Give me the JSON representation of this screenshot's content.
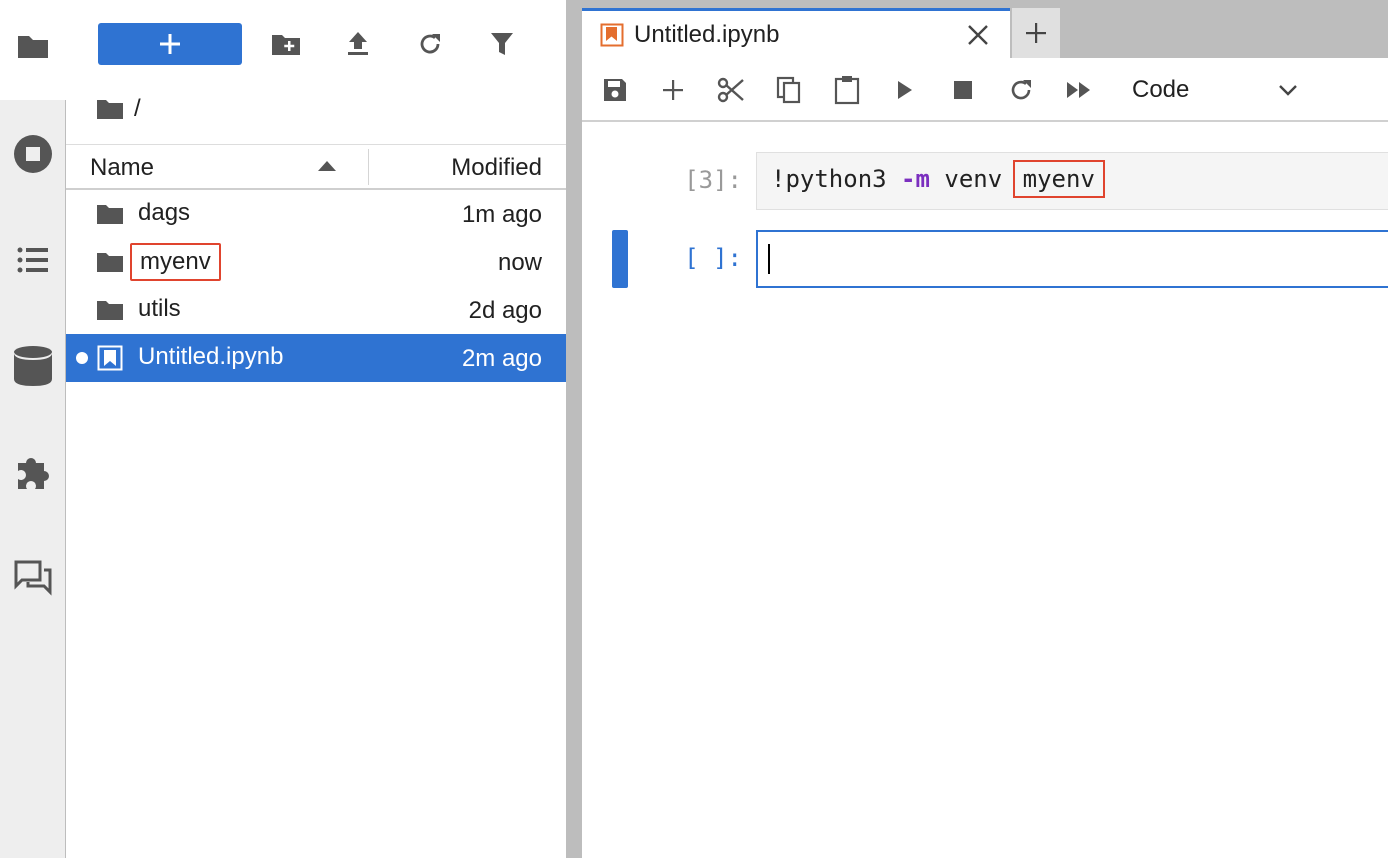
{
  "file_browser": {
    "breadcrumb": "/",
    "columns": {
      "name": "Name",
      "modified": "Modified"
    },
    "items": [
      {
        "name": "dags",
        "modified": "1m ago",
        "type": "folder"
      },
      {
        "name": "myenv",
        "modified": "now",
        "type": "folder",
        "highlighted": true
      },
      {
        "name": "utils",
        "modified": "2d ago",
        "type": "folder"
      },
      {
        "name": "Untitled.ipynb",
        "modified": "2m ago",
        "type": "notebook",
        "selected": true
      }
    ]
  },
  "tabs": {
    "active_label": "Untitled.ipynb"
  },
  "toolbar": {
    "cell_type": "Code"
  },
  "cells": [
    {
      "prompt": "[3]:",
      "code_prefix": "!python3 ",
      "code_flag": "-m",
      "code_mid": " venv ",
      "code_highlight": "myenv"
    },
    {
      "prompt": "[ ]:",
      "code": ""
    }
  ],
  "colors": {
    "accent": "#2f73d2",
    "highlight_box": "#e0442e",
    "notebook_icon": "#e46e2e"
  }
}
